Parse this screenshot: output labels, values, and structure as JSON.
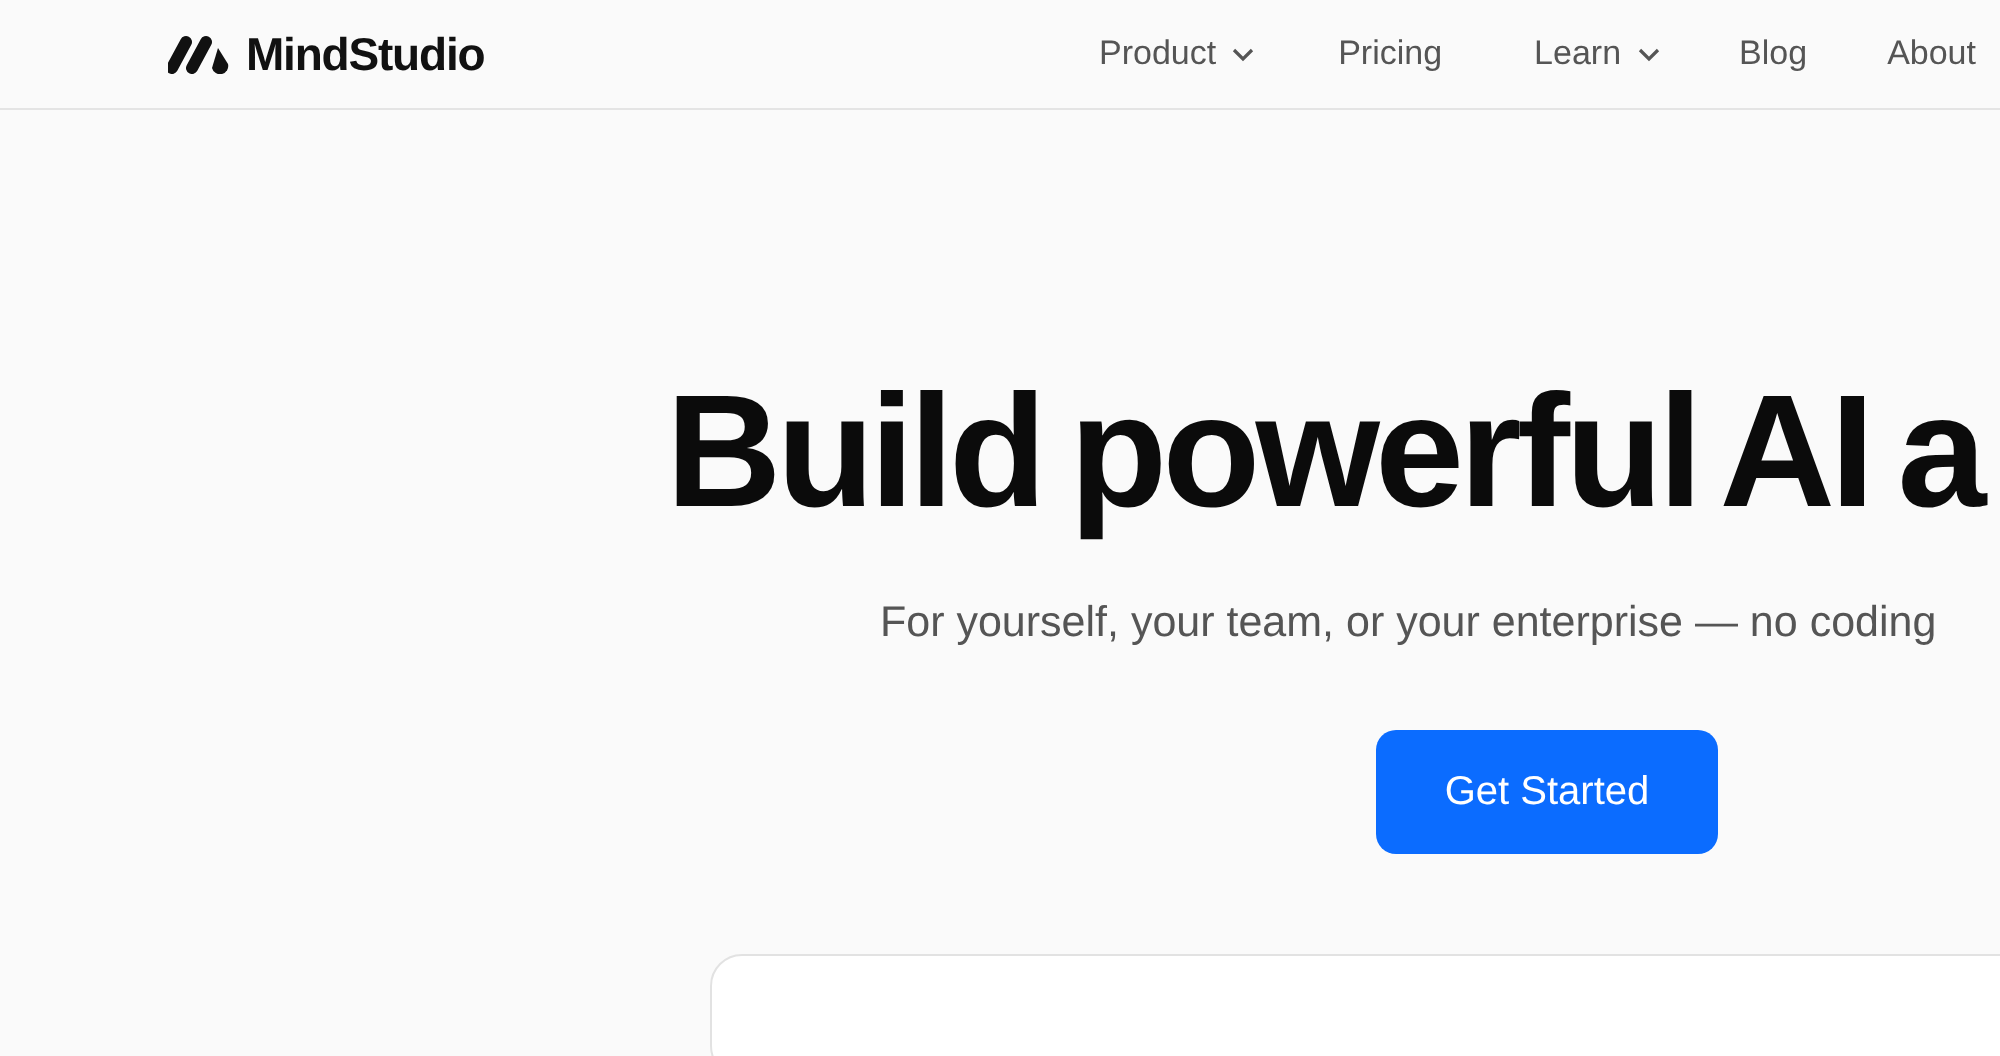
{
  "header": {
    "logo": "MindStudio",
    "nav": [
      {
        "label": "Product",
        "dropdown": true
      },
      {
        "label": "Pricing",
        "dropdown": false
      },
      {
        "label": "Learn",
        "dropdown": true
      },
      {
        "label": "Blog",
        "dropdown": false
      },
      {
        "label": "About",
        "dropdown": false
      }
    ]
  },
  "hero": {
    "heading": "Build powerful AI a",
    "subtitle": "For yourself, your team, or your enterprise — no coding",
    "button": "Get Started"
  }
}
